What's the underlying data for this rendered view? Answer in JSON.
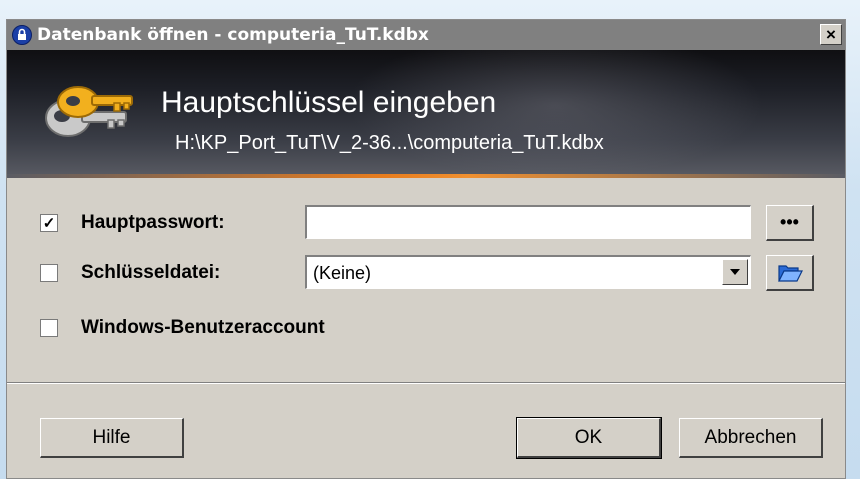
{
  "window": {
    "title": "Datenbank öffnen - computeria_TuT.kdbx",
    "close_label": "×"
  },
  "banner": {
    "title": "Hauptschlüssel eingeben",
    "path": "H:\\KP_Port_TuT\\V_2-36...\\computeria_TuT.kdbx",
    "icon": "key-icon"
  },
  "form": {
    "master_password": {
      "label": "Hauptpasswort:",
      "checked": true,
      "value": "",
      "reveal_label": "•••"
    },
    "key_file": {
      "label": "Schlüsseldatei:",
      "checked": false,
      "selected": "(Keine)",
      "browse_icon": "folder-open-icon"
    },
    "windows_account": {
      "label": "Windows-Benutzeraccount",
      "checked": false
    }
  },
  "buttons": {
    "help": "Hilfe",
    "ok": "OK",
    "cancel": "Abbrechen"
  },
  "colors": {
    "dialog_bg": "#d4d0c8",
    "titlebar": "#808080",
    "banner_dark": "#1d1f26",
    "accent_orange": "#e87d1e"
  }
}
